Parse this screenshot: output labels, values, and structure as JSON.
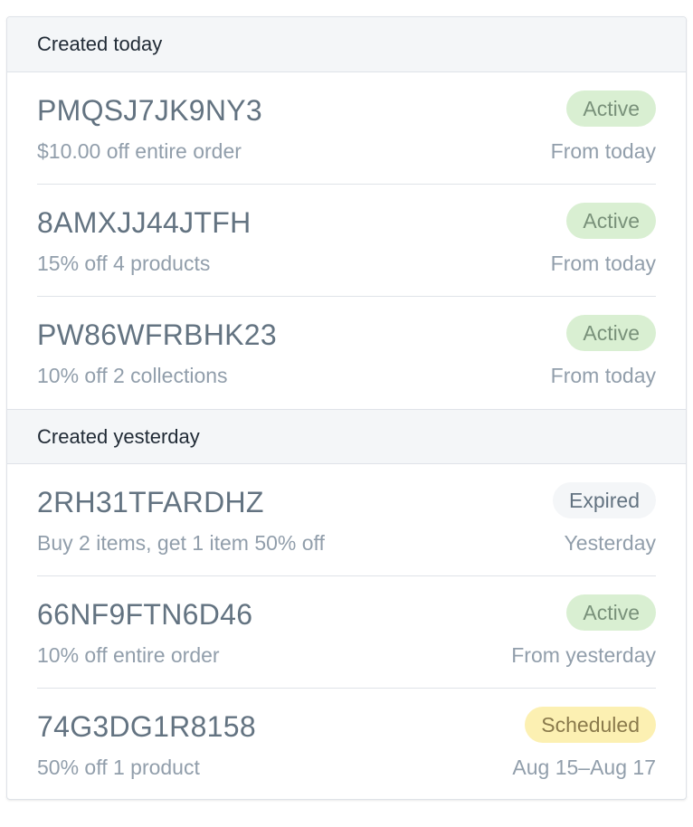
{
  "colors": {
    "active_bg": "#d9efd2",
    "active_text": "#79917a",
    "expired_bg": "#f4f6f8",
    "expired_text": "#637381",
    "scheduled_bg": "#fcf0b2",
    "scheduled_text": "#8a7a4c"
  },
  "sections": [
    {
      "title": "Created today",
      "items": [
        {
          "code": "PMQSJ7JK9NY3",
          "description": "$10.00 off entire order",
          "status": "Active",
          "status_type": "active",
          "date": "From today"
        },
        {
          "code": "8AMXJJ44JTFH",
          "description": "15% off 4 products",
          "status": "Active",
          "status_type": "active",
          "date": "From today"
        },
        {
          "code": "PW86WFRBHK23",
          "description": "10% off 2 collections",
          "status": "Active",
          "status_type": "active",
          "date": "From today"
        }
      ]
    },
    {
      "title": "Created yesterday",
      "items": [
        {
          "code": "2RH31TFARDHZ",
          "description": "Buy 2 items, get 1 item 50% off",
          "status": "Expired",
          "status_type": "expired",
          "date": "Yesterday"
        },
        {
          "code": "66NF9FTN6D46",
          "description": "10% off entire order",
          "status": "Active",
          "status_type": "active",
          "date": "From yesterday"
        },
        {
          "code": "74G3DG1R8158",
          "description": "50% off 1 product",
          "status": "Scheduled",
          "status_type": "scheduled",
          "date": "Aug 15–Aug 17"
        }
      ]
    }
  ]
}
